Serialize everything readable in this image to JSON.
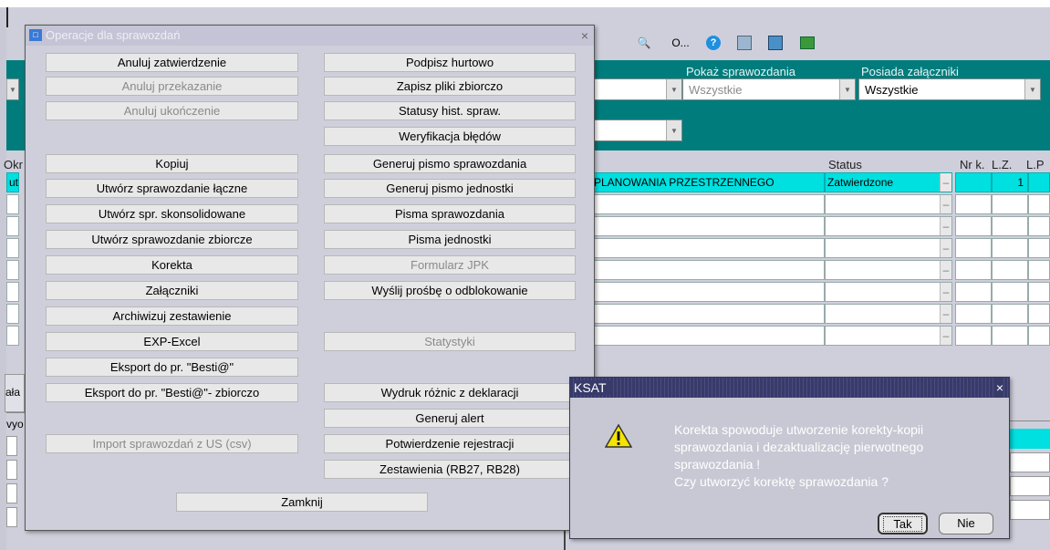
{
  "toolbar": {
    "o_label": "O..."
  },
  "filters": {
    "pokaz_label": "Pokaż sprawozdania",
    "pokaz_value": "Wszystkie",
    "posiada_label": "Posiada załączniki",
    "posiada_value": "Wszystkie"
  },
  "grid": {
    "col_left": "Okr",
    "col_status": "Status",
    "col_nrk": "Nr k.",
    "col_lz": "L.Z.",
    "col_lp": "L.P",
    "row1": {
      "left": "ut",
      "name": "PLANOWANIA PRZESTRZENNEGO",
      "status": "Zatwierdzone",
      "lz": "1"
    }
  },
  "lower": {
    "tab_fragment": "ała",
    "field_fragment": "vyo"
  },
  "ops_dialog": {
    "title": "Operacje dla sprawozdań",
    "left_buttons": [
      {
        "label": "Anuluj zatwierdzenie",
        "enabled": true
      },
      {
        "label": "Anuluj przekazanie",
        "enabled": false
      },
      {
        "label": "Anuluj ukończenie",
        "enabled": false
      },
      {
        "label": "Kopiuj",
        "enabled": true
      },
      {
        "label": "Utwórz sprawozdanie łączne",
        "enabled": true
      },
      {
        "label": "Utwórz spr. skonsolidowane",
        "enabled": true
      },
      {
        "label": "Utwórz sprawozdanie zbiorcze",
        "enabled": true
      },
      {
        "label": "Korekta",
        "enabled": true
      },
      {
        "label": "Załączniki",
        "enabled": true
      },
      {
        "label": "Archiwizuj zestawienie",
        "enabled": true
      },
      {
        "label": "EXP-Excel",
        "enabled": true
      },
      {
        "label": "Eksport do pr. \"Besti@\"",
        "enabled": true
      },
      {
        "label": "Eksport do pr. \"Besti@\"- zbiorczo",
        "enabled": true
      },
      {
        "label": "Import sprawozdań z US (csv)",
        "enabled": false
      }
    ],
    "right_buttons": [
      {
        "label": "Podpisz hurtowo",
        "enabled": true
      },
      {
        "label": "Zapisz pliki zbiorczo",
        "enabled": true
      },
      {
        "label": "Statusy hist. spraw.",
        "enabled": true
      },
      {
        "label": "Weryfikacja błędów",
        "enabled": true
      },
      {
        "label": "Generuj pismo sprawozdania",
        "enabled": true
      },
      {
        "label": "Generuj pismo jednostki",
        "enabled": true
      },
      {
        "label": "Pisma sprawozdania",
        "enabled": true
      },
      {
        "label": "Pisma jednostki",
        "enabled": true
      },
      {
        "label": "Formularz JPK",
        "enabled": false
      },
      {
        "label": "Wyślij prośbę o odblokowanie",
        "enabled": true
      },
      {
        "label": "Statystyki",
        "enabled": false
      },
      {
        "label": "Wydruk różnic z deklaracji",
        "enabled": true
      },
      {
        "label": "Generuj alert",
        "enabled": true
      },
      {
        "label": "Potwierdzenie rejestracji",
        "enabled": true
      },
      {
        "label": "Zestawienia (RB27, RB28)",
        "enabled": true
      }
    ],
    "close_label": "Zamknij"
  },
  "alert": {
    "title": "KSAT",
    "lines": [
      "Korekta spowoduje utworzenie korekty-kopii",
      "sprawozdania i dezaktualizację pierwotnego",
      "sprawozdania !",
      "Czy utworzyć korektę sprawozdania ?"
    ],
    "yes_label": "Tak",
    "no_label": "Nie"
  },
  "colors": {
    "teal": "#007c7c",
    "selected_row": "#00e0e0",
    "alert_title": "#383a6a"
  }
}
